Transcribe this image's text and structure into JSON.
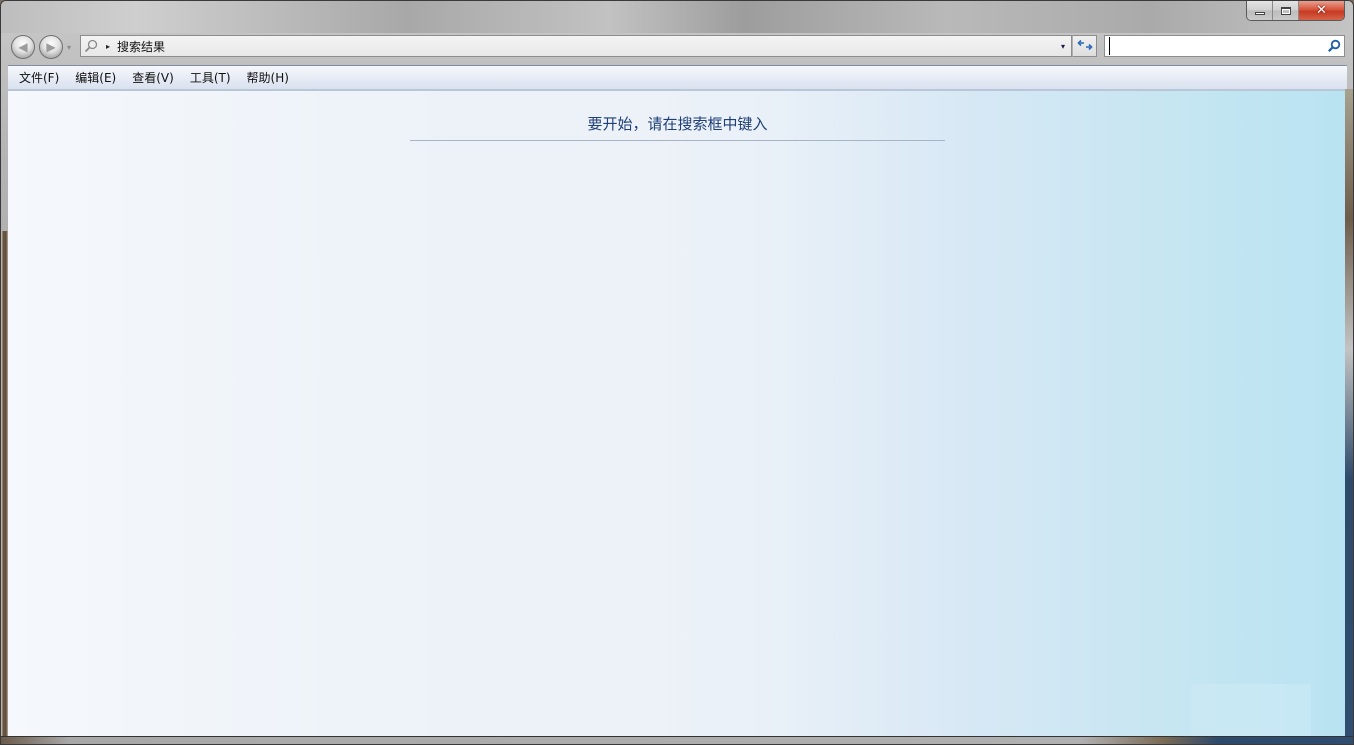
{
  "window": {
    "caption_buttons": {
      "minimize_icon": "minimize-icon",
      "maximize_icon": "maximize-icon",
      "close_icon": "close-icon",
      "close_glyph": "✕"
    }
  },
  "navigation": {
    "back_icon": "back-arrow-icon",
    "forward_icon": "forward-arrow-icon",
    "back_glyph": "◀",
    "forward_glyph": "▶",
    "history_dropdown_glyph": "▾",
    "address": {
      "icon": "search-icon",
      "separator_glyph": "▸",
      "breadcrumb": "搜索结果",
      "dropdown_glyph": "▾"
    },
    "refresh_icon": "refresh-icon",
    "search": {
      "value": "",
      "placeholder": "",
      "icon": "search-icon"
    }
  },
  "menubar": {
    "items": [
      {
        "label": "文件(F)"
      },
      {
        "label": "编辑(E)"
      },
      {
        "label": "查看(V)"
      },
      {
        "label": "工具(T)"
      },
      {
        "label": "帮助(H)"
      }
    ]
  },
  "content": {
    "hint_text": "要开始，请在搜索框中键入"
  },
  "colors": {
    "hint_text": "#1e3f78",
    "close_button": "#c63a22",
    "search_icon": "#1f5fa8"
  }
}
